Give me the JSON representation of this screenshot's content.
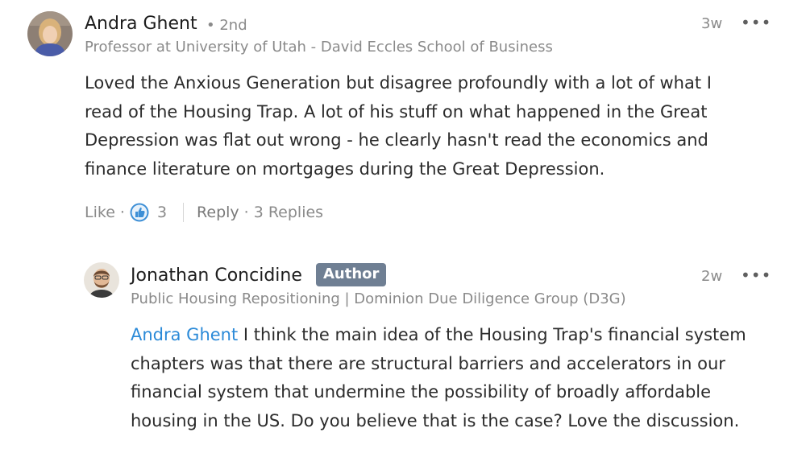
{
  "comments": [
    {
      "author": "Andra Ghent",
      "degree": "• 2nd",
      "headline": "Professor at University of Utah - David Eccles School of Business",
      "time": "3w",
      "more": "•••",
      "body_lines": [
        "Loved the Anxious Generation but disagree profoundly with a lot of what I",
        "read of the Housing Trap. A lot of his stuff on what happened in the Great",
        "Depression was flat out wrong - he clearly hasn't read the economics and",
        "finance literature on mortgages during the Great Depression."
      ],
      "actions": {
        "like": "Like",
        "sep1": "·",
        "reaction_count": "3",
        "reply": "Reply",
        "sep2": "·",
        "replies": "3 Replies"
      }
    }
  ],
  "reply": {
    "author": "Jonathan Concidine",
    "badge": "Author",
    "headline": "Public Housing Repositioning | Dominion Due Diligence Group (D3G)",
    "time": "2w",
    "more": "•••",
    "mention": "Andra Ghent",
    "body_first": " I think the main idea of the Housing Trap's financial system",
    "body_lines": [
      "chapters was that there are structural barriers and accelerators in our",
      "financial system that undermine the possibility of broadly affordable",
      "housing in the US. Do you believe that is the case? Love the discussion."
    ]
  },
  "colors": {
    "mention": "#2b8ad8",
    "badge_bg": "#6f7f93",
    "like_icon": "#3d8fd6",
    "secondary_text": "#8a8a8a"
  },
  "icons": {
    "like": "thumbs-up-icon",
    "more": "more-options-icon"
  }
}
